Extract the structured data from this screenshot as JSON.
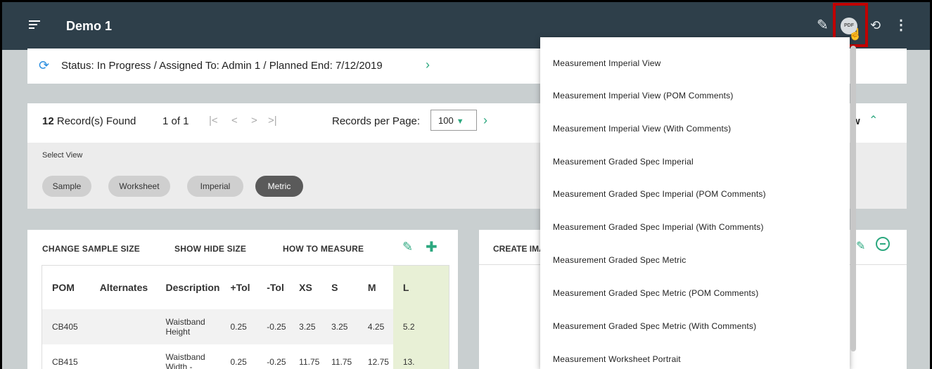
{
  "app": {
    "title": "Demo 1"
  },
  "toolbar": {
    "pdf_label": "PDF",
    "icons": [
      "menu-icon",
      "pencil-icon",
      "pdf-icon",
      "history-icon",
      "more-vertical-icon"
    ]
  },
  "status": {
    "text": "Status: In Progress / Assigned To: Admin 1 / Planned End: 7/12/2019"
  },
  "records": {
    "count": "12",
    "count_suffix": " Record(s) Found",
    "page": "1 of 1",
    "pager": [
      "|<",
      "<",
      ">",
      ">|"
    ],
    "per_page_label": "Records per Page:",
    "per_page_value": "100",
    "collapse_text": "w",
    "select_view_label": "Select View",
    "views": [
      {
        "label": "Sample",
        "active": false
      },
      {
        "label": "Worksheet",
        "active": false
      },
      {
        "label": "Imperial",
        "active": false
      },
      {
        "label": "Metric",
        "active": true
      }
    ]
  },
  "table_card": {
    "links": [
      "CHANGE SAMPLE SIZE",
      "SHOW HIDE SIZE",
      "HOW TO MEASURE"
    ],
    "columns": [
      "POM",
      "Alternates",
      "Description",
      "+Tol",
      "-Tol",
      "XS",
      "S",
      "M",
      "L"
    ],
    "rows": [
      {
        "pom": "CB405",
        "alternates": "",
        "description": [
          "Waistband",
          "Height"
        ],
        "ptol": "0.25",
        "ntol": "-0.25",
        "xs": "3.25",
        "s": "3.25",
        "m": "4.25",
        "l": "5.2"
      },
      {
        "pom": "CB415",
        "alternates": "",
        "description": [
          "Waistband",
          "Width -"
        ],
        "ptol": "0.25",
        "ntol": "-0.25",
        "xs": "11.75",
        "s": "11.75",
        "m": "12.75",
        "l": "13."
      }
    ]
  },
  "create_card": {
    "title": "CREATE IMA"
  },
  "dropdown": {
    "items": [
      "Measurement Imperial View",
      "Measurement Imperial View (POM Comments)",
      "Measurement Imperial View (With Comments)",
      "Measurement Graded Spec Imperial",
      "Measurement Graded Spec Imperial (POM Comments)",
      "Measurement Graded Spec Imperial (With Comments)",
      "Measurement Graded Spec Metric",
      "Measurement Graded Spec Metric (POM Comments)",
      "Measurement Graded Spec Metric (With Comments)",
      "Measurement Worksheet Portrait"
    ]
  },
  "colors": {
    "topbar": "#2e3f4a",
    "accent_green": "#2ca87f",
    "status_blue": "#2a8ee0",
    "highlight_red": "#c00000"
  }
}
